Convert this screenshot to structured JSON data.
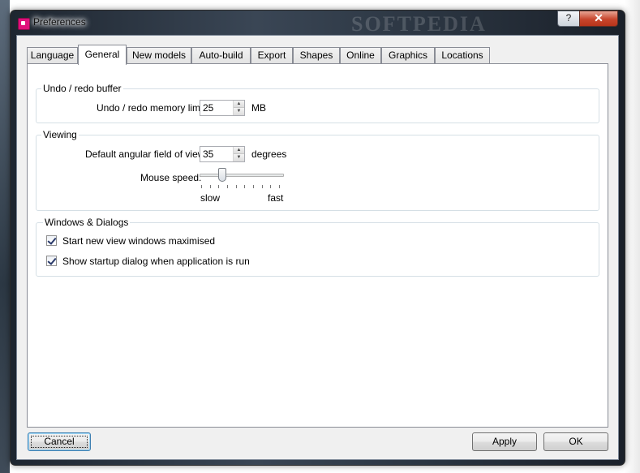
{
  "window": {
    "title": "Preferences",
    "watermark": "SOFTPEDIA",
    "help_label": "?",
    "close_label": "✕"
  },
  "tabs": [
    {
      "label": "Language",
      "active": false
    },
    {
      "label": "General",
      "active": true
    },
    {
      "label": "New models",
      "active": false
    },
    {
      "label": "Auto-build",
      "active": false
    },
    {
      "label": "Export",
      "active": false
    },
    {
      "label": "Shapes",
      "active": false
    },
    {
      "label": "Online",
      "active": false
    },
    {
      "label": "Graphics",
      "active": false
    },
    {
      "label": "Locations",
      "active": false
    }
  ],
  "undo": {
    "group_title": "Undo / redo buffer",
    "limit_label": "Undo / redo memory limit:",
    "limit_value": "25",
    "limit_unit": "MB"
  },
  "viewing": {
    "group_title": "Viewing",
    "fov_label": "Default angular field of view:",
    "fov_value": "35",
    "fov_unit": "degrees",
    "mouse_speed_label": "Mouse speed:",
    "mouse_speed_fraction": 0.25,
    "slow_label": "slow",
    "fast_label": "fast"
  },
  "dialogs": {
    "group_title": "Windows & Dialogs",
    "options": [
      {
        "label": "Start new view windows maximised",
        "checked": true
      },
      {
        "label": "Show startup dialog when application is run",
        "checked": true
      }
    ]
  },
  "buttons": {
    "cancel": "Cancel",
    "apply": "Apply",
    "ok": "OK"
  },
  "icons": {
    "app": "app-icon",
    "spin_up": "spin-up-arrow",
    "spin_down": "spin-down-arrow"
  }
}
